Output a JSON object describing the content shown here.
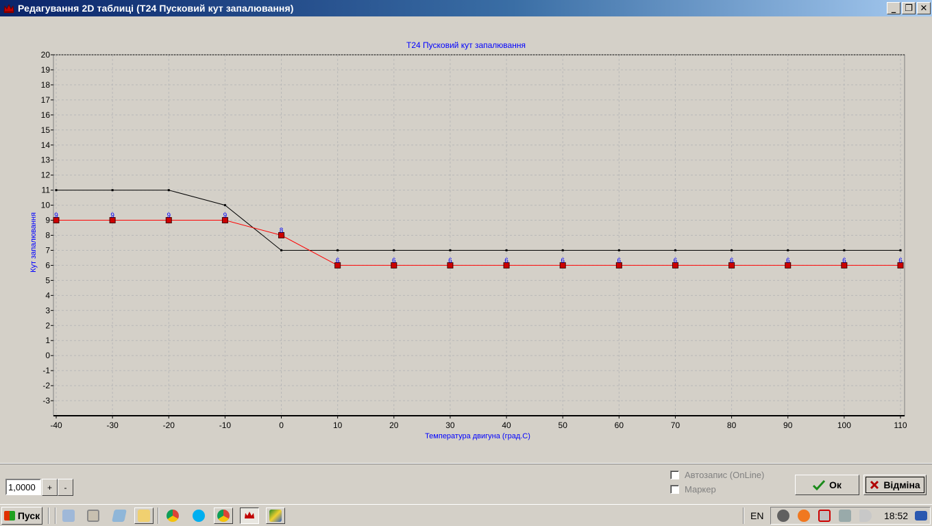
{
  "window": {
    "title": "Редагування 2D таблиці (T24 Пусковий кут запалювання)",
    "minimize": "_",
    "restore": "❐",
    "close": "✕"
  },
  "chart_data": {
    "type": "line",
    "title": "T24 Пусковий кут запалювання",
    "xlabel": "Температура двигуна (град.С)",
    "ylabel": "Кут запалювання",
    "x": [
      -40,
      -30,
      -20,
      -10,
      0,
      10,
      20,
      30,
      40,
      50,
      60,
      70,
      80,
      90,
      100,
      110
    ],
    "xlim": [
      -40,
      110
    ],
    "ylim": [
      -4,
      20
    ],
    "yticks": [
      20,
      19,
      18,
      17,
      16,
      15,
      14,
      13,
      12,
      11,
      10,
      9,
      8,
      7,
      6,
      5,
      4,
      3,
      2,
      1,
      0,
      -1,
      -2,
      -3
    ],
    "grid": true,
    "series": [
      {
        "values": [
          11,
          11,
          11,
          10,
          7,
          7,
          7,
          7,
          7,
          7,
          7,
          7,
          7,
          7,
          7,
          7
        ],
        "color": "#000000"
      },
      {
        "values": [
          9,
          9,
          9,
          9,
          8,
          6,
          6,
          6,
          6,
          6,
          6,
          6,
          6,
          6,
          6,
          6
        ],
        "color": "#ff0000",
        "marker": "square",
        "data_labels": true
      }
    ],
    "colors": {
      "label_text": "#0000ff",
      "grid": "#b8b8b8",
      "marker_fill": "#cc0000"
    }
  },
  "controls": {
    "step_value": "1,0000",
    "plus": "+",
    "minus": "-",
    "autosave_label": "Автозапис (OnLine)",
    "marker_label": "Маркер",
    "ok_label": "Ок",
    "cancel_label": "Відміна"
  },
  "taskbar": {
    "start_label": "Пуск",
    "language": "EN",
    "clock": "18:52",
    "apps": [
      "calculator-icon",
      "media-player-icon",
      "notes-icon",
      "folder-icon",
      "chrome-icon",
      "skype-icon",
      "chrome-icon",
      "crown-app-icon",
      "paint-icon"
    ],
    "tray": [
      "avast-warning-icon",
      "avast-icon",
      "security-icon",
      "network-icon",
      "volume-icon",
      "desktop-icon"
    ]
  }
}
